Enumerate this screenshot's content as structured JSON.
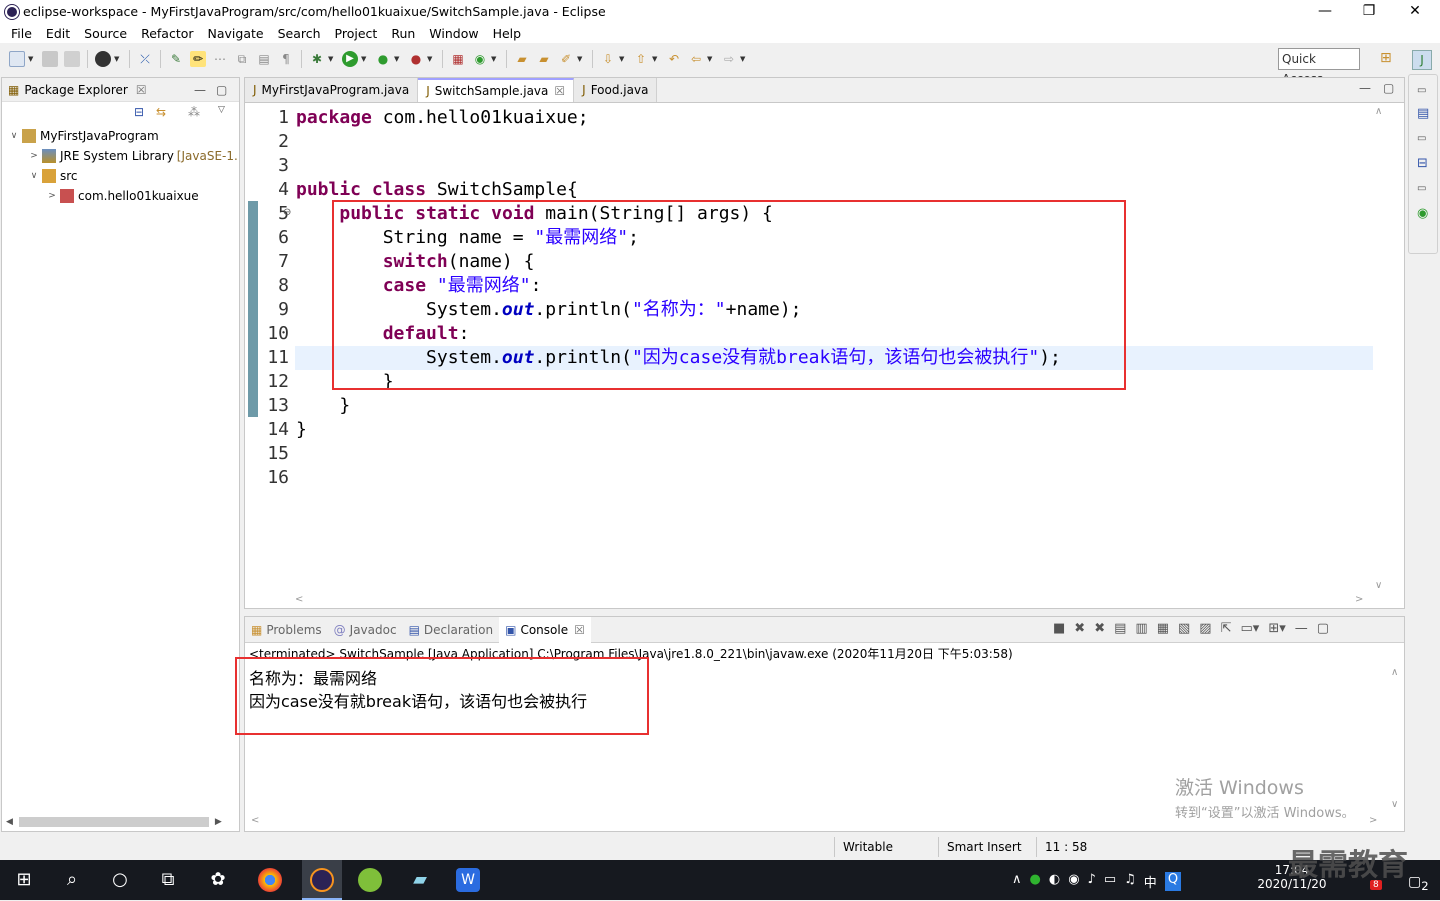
{
  "window": {
    "title": "eclipse-workspace - MyFirstJavaProgram/src/com/hello01kuaixue/SwitchSample.java - Eclipse",
    "min": "—",
    "max": "❐",
    "close": "✕"
  },
  "menu": [
    "File",
    "Edit",
    "Source",
    "Refactor",
    "Navigate",
    "Search",
    "Project",
    "Run",
    "Window",
    "Help"
  ],
  "quick_access": "Quick Access",
  "package_explorer": {
    "title": "Package Explorer",
    "tree": [
      {
        "label": "MyFirstJavaProgram",
        "extra": "",
        "level": 0,
        "arrow": "∨"
      },
      {
        "label": "JRE System Library",
        "extra": "[JavaSE-1.",
        "level": 1,
        "arrow": ">"
      },
      {
        "label": "src",
        "extra": "",
        "level": 1,
        "arrow": "∨"
      },
      {
        "label": "com.hello01kuaixue",
        "extra": "",
        "level": 2,
        "arrow": ">"
      }
    ]
  },
  "editor": {
    "tabs": [
      "MyFirstJavaProgram.java",
      "SwitchSample.java",
      "Food.java"
    ],
    "active_tab": 1,
    "line_numbers": [
      "1",
      "2",
      "3",
      "4",
      "5",
      "6",
      "7",
      "8",
      "9",
      "10",
      "11",
      "12",
      "13",
      "14",
      "15",
      "16"
    ]
  },
  "console": {
    "tabs": [
      "Problems",
      "Javadoc",
      "Declaration",
      "Console"
    ],
    "active_tab": 3,
    "terminated": "<terminated> SwitchSample [Java Application] C:\\Program Files\\Java\\jre1.8.0_221\\bin\\javaw.exe (2020年11月20日 下午5:03:58)",
    "output": [
      "名称为：最需网络",
      "因为case没有就break语句，该语句也会被执行"
    ]
  },
  "status": {
    "writable": "Writable",
    "insert_mode": "Smart Insert",
    "position": "11 : 58"
  },
  "watermark": {
    "line1": "激活 Windows",
    "line2": "转到“设置”以激活 Windows。"
  },
  "taskbar": {
    "time": "17:04",
    "date": "2020/11/20",
    "ime": "中",
    "brand": "最需教育",
    "badge1": "8",
    "badge2": "2"
  },
  "colors": {
    "keyword": "#7f0055",
    "string": "#2a00ff",
    "highlight_box": "#e83030",
    "current_line": "#e8f2fe"
  }
}
